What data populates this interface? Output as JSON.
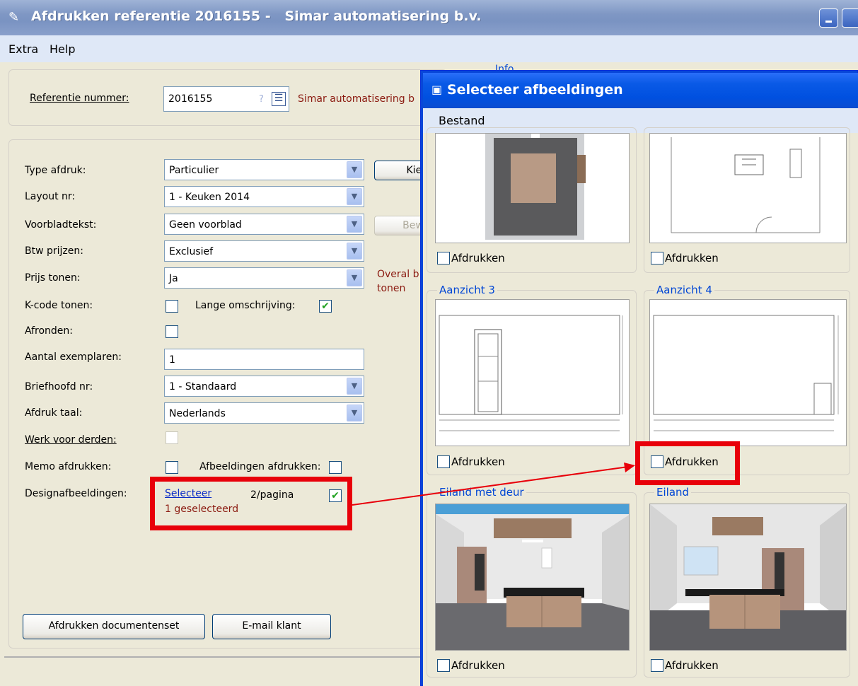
{
  "window": {
    "title": "Afdrukken referentie 2016155 -   Simar automatisering b.v.",
    "menu": [
      "Extra",
      "Help"
    ]
  },
  "form": {
    "referentie_label": "Referentie nummer:",
    "referentie_value": "2016155",
    "referentie_question": "?",
    "company_name": "Simar automatisering b",
    "info_label": "Info",
    "rows": {
      "type_afdruk": {
        "label": "Type afdruk:",
        "value": "Particulier"
      },
      "layout_nr": {
        "label": "Layout nr:",
        "value": "1 - Keuken 2014"
      },
      "voorbladtekst": {
        "label": "Voorbladtekst:",
        "value": "Geen voorblad"
      },
      "btw_prijzen": {
        "label": "Btw prijzen:",
        "value": "Exclusief"
      },
      "prijs_tonen": {
        "label": "Prijs tonen:",
        "value": "Ja"
      },
      "k_code": {
        "label": "K-code tonen:",
        "checked": false
      },
      "lange_omschrijving": {
        "label": "Lange omschrijving:",
        "checked": true
      },
      "afronden": {
        "label": "Afronden:",
        "checked": false
      },
      "aantal_exemplaren": {
        "label": "Aantal exemplaren:",
        "value": "1"
      },
      "briefhoofd_nr": {
        "label": "Briefhoofd nr:",
        "value": "1 - Standaard"
      },
      "afdruk_taal": {
        "label": "Afdruk taal:",
        "value": "Nederlands"
      },
      "werk_voor_derden": {
        "label": "Werk voor derden:",
        "checked": false
      },
      "memo_afdrukken": {
        "label": "Memo afdrukken:",
        "checked": false
      },
      "afbeeldingen_afdrukken": {
        "label": "Afbeeldingen afdrukken:",
        "checked": false
      },
      "designafbeeldingen": {
        "label": "Designafbeeldingen:",
        "link": "Selecteer",
        "count": "1 geselecteerd",
        "per_page": "2/pagina",
        "per_page_checked": true
      }
    },
    "kies_button": "Kies",
    "bew_button": "Bew",
    "overal_text_1": "Overal b",
    "overal_text_2": "tonen",
    "afdrukken_button": "Afdrukken documentenset",
    "email_button": "E-mail klant"
  },
  "dialog": {
    "title": "Selecteer afbeeldingen",
    "menu": [
      "Bestand"
    ],
    "panels": [
      {
        "label": "",
        "print_label": "Afdrukken",
        "checked": false
      },
      {
        "label": "",
        "print_label": "Afdrukken",
        "checked": false
      },
      {
        "label": "Aanzicht 3",
        "print_label": "Afdrukken",
        "checked": false
      },
      {
        "label": "Aanzicht 4",
        "print_label": "Afdrukken",
        "checked": false
      },
      {
        "label": "Eiland met deur",
        "print_label": "Afdrukken",
        "checked": false
      },
      {
        "label": "Eiland",
        "print_label": "Afdrukken",
        "checked": false
      }
    ]
  },
  "colors": {
    "annotation": "#e8000a",
    "dialog_border": "#0846d8",
    "label_blue": "#0046d5"
  }
}
